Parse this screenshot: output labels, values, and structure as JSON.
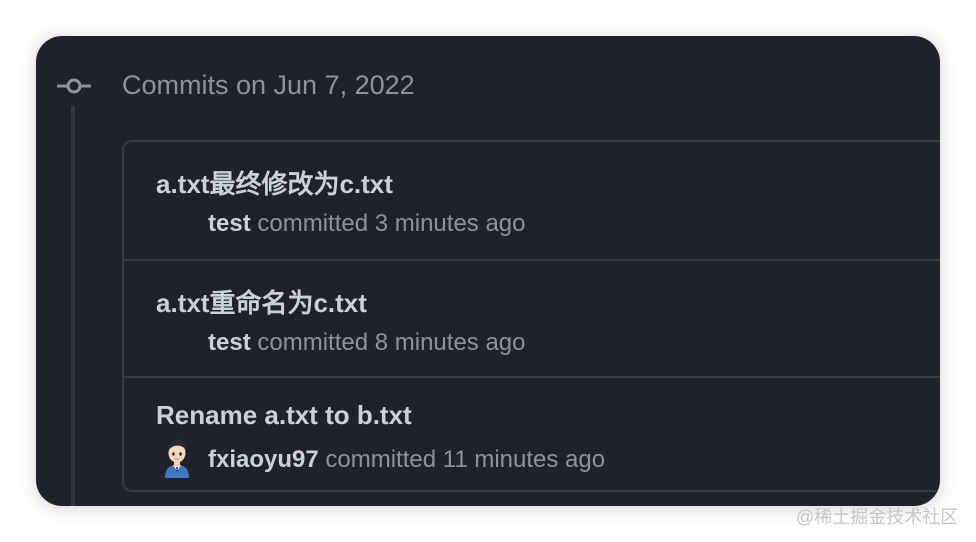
{
  "timeline": {
    "group_title": "Commits on Jun 7, 2022",
    "icon": "git-commit-icon"
  },
  "commits": [
    {
      "title": "a.txt最终修改为c.txt",
      "author": "test",
      "action": "committed",
      "time": "3 minutes ago",
      "has_avatar": false
    },
    {
      "title": "a.txt重命名为c.txt",
      "author": "test",
      "action": "committed",
      "time": "8 minutes ago",
      "has_avatar": false
    },
    {
      "title": "Rename a.txt to b.txt",
      "author": "fxiaoyu97",
      "action": "committed",
      "time": "11 minutes ago",
      "has_avatar": true,
      "avatar_icon": "user-avatar-icon"
    }
  ],
  "watermark": "@稀土掘金技术社区",
  "colors": {
    "background": "#1f2329",
    "border": "#363c44",
    "text_primary": "#c9d1d9",
    "text_muted": "#8b939d"
  }
}
